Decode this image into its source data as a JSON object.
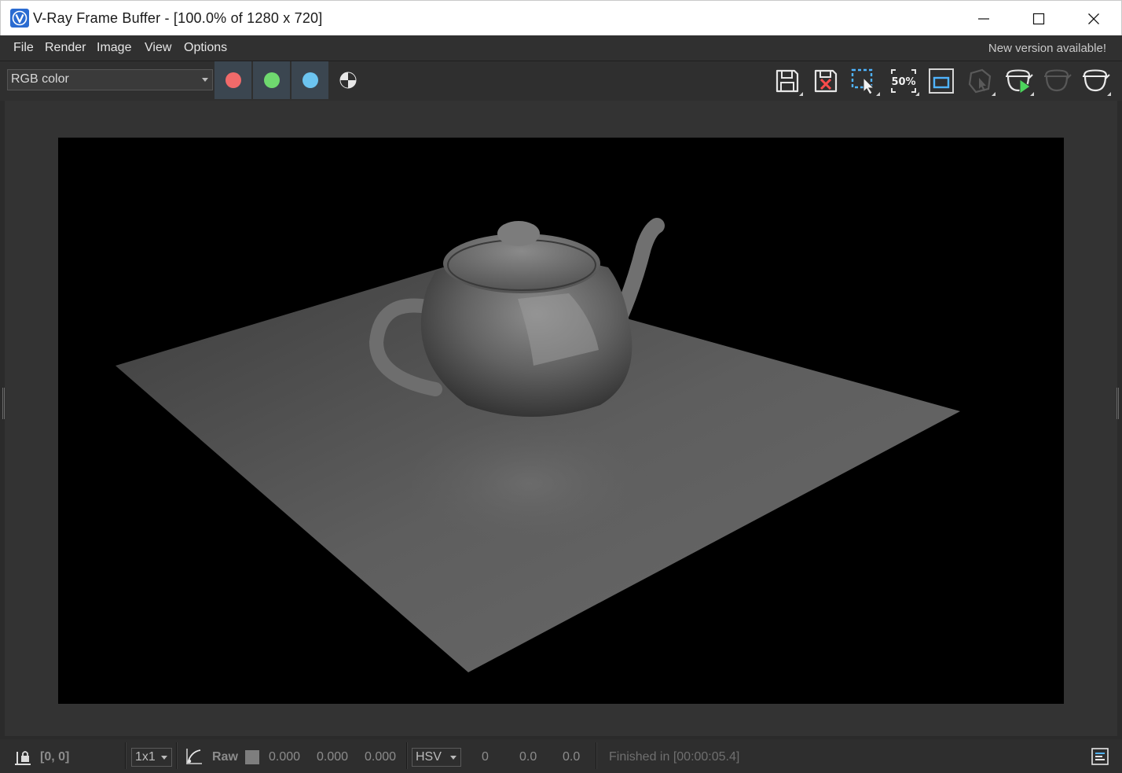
{
  "window": {
    "title": "V-Ray Frame Buffer - [100.0% of 1280 x 720]"
  },
  "menu": {
    "items": [
      "File",
      "Render",
      "Image",
      "View",
      "Options"
    ],
    "notice": "New version available!"
  },
  "toolbar": {
    "channel": "RGB color",
    "channel_buttons": [
      {
        "name": "red-channel",
        "color": "#f06a6a"
      },
      {
        "name": "green-channel",
        "color": "#6fd96f"
      },
      {
        "name": "blue-channel",
        "color": "#6cc4f0"
      }
    ],
    "right_icons": [
      "save-image-icon",
      "clear-image-icon",
      "region-render-icon",
      "zoom-50-icon",
      "render-region-frame-icon",
      "track-mouse-icon",
      "render-interactive-icon",
      "stop-render-icon",
      "render-icon"
    ],
    "zoom_label": "50%"
  },
  "status": {
    "coords": "[0, 0]",
    "sample_size": "1x1",
    "raw_label": "Raw",
    "rgb_values": [
      "0.000",
      "0.000",
      "0.000"
    ],
    "color_mode": "HSV",
    "hsv_values": [
      "0",
      "0.0",
      "0.0"
    ],
    "render_status": "Finished in [00:00:05.4]"
  },
  "colors": {
    "accent_blue": "#2a6bd1",
    "render_background": "#000000"
  }
}
